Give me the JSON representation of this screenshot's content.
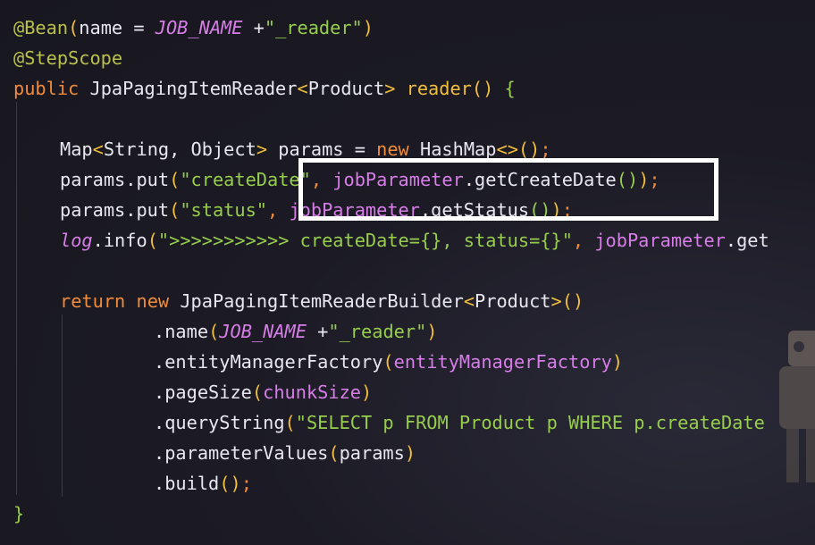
{
  "code": {
    "bean_annotation": "@Bean",
    "bean_open": "(",
    "bean_name_arg": "name = ",
    "job_name": "JOB_NAME",
    "plus": " +",
    "reader_suffix": "\"_reader\"",
    "bean_close": ")",
    "stepscope": "@StepScope",
    "kw_public": "public",
    "reader_type": "JpaPagingItemReader",
    "lt": "<",
    "product": "Product",
    "gt": ">",
    "reader_method": "reader",
    "parens": "()",
    "open_brace": "{",
    "map_type": "Map",
    "string_type": "String",
    "object_type": "Object",
    "params_decl": " params = ",
    "kw_new": "new",
    "hashmap": "HashMap",
    "diamond": "<>",
    "semi": ";",
    "params_put": "params.put",
    "create_date_key": "\"createDate\"",
    "comma": ", ",
    "job_parameter": "jobParameter",
    "get_create_date": ".getCreateDate",
    "status_key": "\"status\"",
    "get_status": ".getStatus",
    "log_var": "log",
    "info_call": ".info",
    "log_message": "\">>>>>>>>>>> createDate={}, status={}\"",
    "get_trunc": ".get",
    "kw_return": "return",
    "builder_type": "JpaPagingItemReaderBuilder",
    "name_call": ".name",
    "emf_call": ".entityManagerFactory",
    "emf_arg": "entityManagerFactory",
    "page_size_call": ".pageSize",
    "chunk_size": "chunkSize",
    "query_call": ".queryString",
    "query_string": "\"SELECT p FROM Product p WHERE p.createDate",
    "param_values_call": ".parameterValues",
    "params_arg": "params",
    "build_call": ".build",
    "close_brace": "}"
  }
}
